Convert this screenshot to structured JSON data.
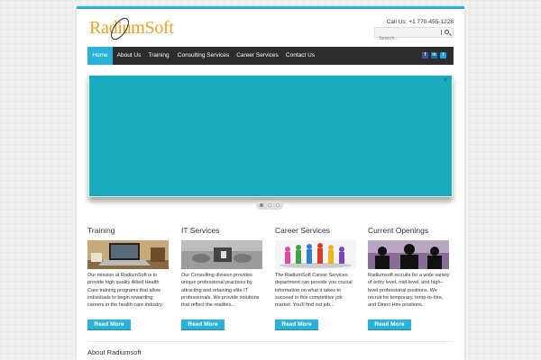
{
  "header": {
    "logo_text": "RadiumSoft",
    "phone": "Call Us: +1 770-455-1228",
    "search_placeholder": "Search..."
  },
  "nav": {
    "items": [
      "Home",
      "About Us",
      "Training",
      "Consulting Services",
      "Career Services",
      "Contact Us"
    ],
    "active": "Home",
    "social": [
      "facebook-icon",
      "linkedin-icon",
      "twitter-icon"
    ]
  },
  "slider": {
    "close_symbol": "×",
    "dots": 3,
    "active_dot": 1,
    "color": "#1aacbd"
  },
  "sections": [
    {
      "title": "Training",
      "text": "Our mission at RadiumSoft is to provide high quality Allied Health Care training programs that allow individuals to begin rewarding careers in the health care industry.",
      "button": "Read More"
    },
    {
      "title": "IT Services",
      "text": "Our Consulting division provides unique professional practices by attracting and retaining elite IT professionals. We provide solutions that reflect the realities...",
      "button": "Read More"
    },
    {
      "title": "Career Services",
      "text": "The RadiumSoft Career Services department can provide you crucial information on what it takes to succeed in this competitive job market. You'll find out job...",
      "button": "Read More"
    },
    {
      "title": "Current Openings",
      "text": "Radiumsoft recruits for a wide variety of entry level, mid-level, and high–level professional positions. We recruit for temporary, temp-to-hire, and Direct Hire positions.",
      "button": "Read More"
    }
  ],
  "about_title": "About Radiumsoft",
  "colors": {
    "accent": "#27b3d6",
    "logo": "#f0a020",
    "navbar": "#2d2d2d"
  }
}
